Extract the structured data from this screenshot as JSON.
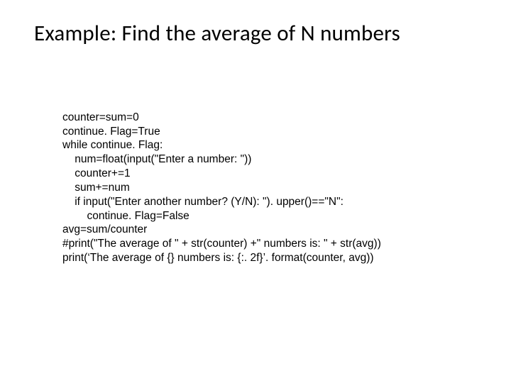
{
  "title": "Example: Find the average of N numbers",
  "code": {
    "l1": "counter=sum=0",
    "l2": "continue. Flag=True",
    "l3": "while continue. Flag:",
    "l4": "    num=float(input(\"Enter a number: \"))",
    "l5": "    counter+=1",
    "l6": "    sum+=num",
    "l7": "    if input(\"Enter another number? (Y/N): \"). upper()==\"N\":",
    "l8": "        continue. Flag=False",
    "l9": "avg=sum/counter",
    "l10": "#print(\"The average of \" + str(counter) +\" numbers is: \" + str(avg))",
    "l11": "print(‘The average of {} numbers is: {:. 2f}’. format(counter, avg))"
  }
}
